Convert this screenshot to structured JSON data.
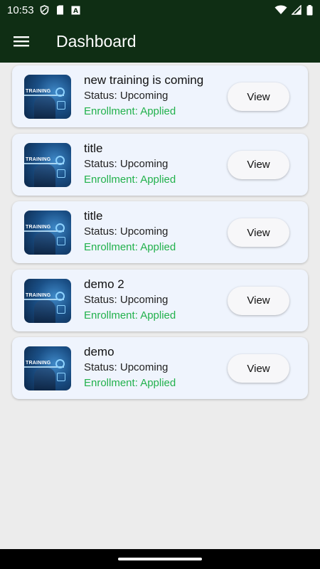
{
  "status_bar": {
    "time": "10:53",
    "icons": [
      "shield-icon",
      "sd-card-icon",
      "text-a-icon",
      "wifi-icon",
      "signal-icon",
      "battery-icon"
    ]
  },
  "app_bar": {
    "title": "Dashboard",
    "menu_icon": "hamburger-menu-icon",
    "background_color": "#0f2e14"
  },
  "trainings": [
    {
      "title": "new training is coming",
      "status": "Status: Upcoming",
      "enrollment": "Enrollment: Applied",
      "button": "View",
      "image_text": "TRAINING"
    },
    {
      "title": "title",
      "status": "Status: Upcoming",
      "enrollment": "Enrollment: Applied",
      "button": "View",
      "image_text": "TRAINING"
    },
    {
      "title": "title",
      "status": "Status: Upcoming",
      "enrollment": "Enrollment: Applied",
      "button": "View",
      "image_text": "TRAINING"
    },
    {
      "title": "demo 2",
      "status": "Status: Upcoming",
      "enrollment": "Enrollment: Applied",
      "button": "View",
      "image_text": "TRAINING"
    },
    {
      "title": "demo",
      "status": "Status: Upcoming",
      "enrollment": "Enrollment: Applied",
      "button": "View",
      "image_text": "TRAINING"
    }
  ],
  "colors": {
    "enrollment_text": "#22b14c",
    "card_background": "#eff4fd",
    "page_background": "#ececec"
  }
}
